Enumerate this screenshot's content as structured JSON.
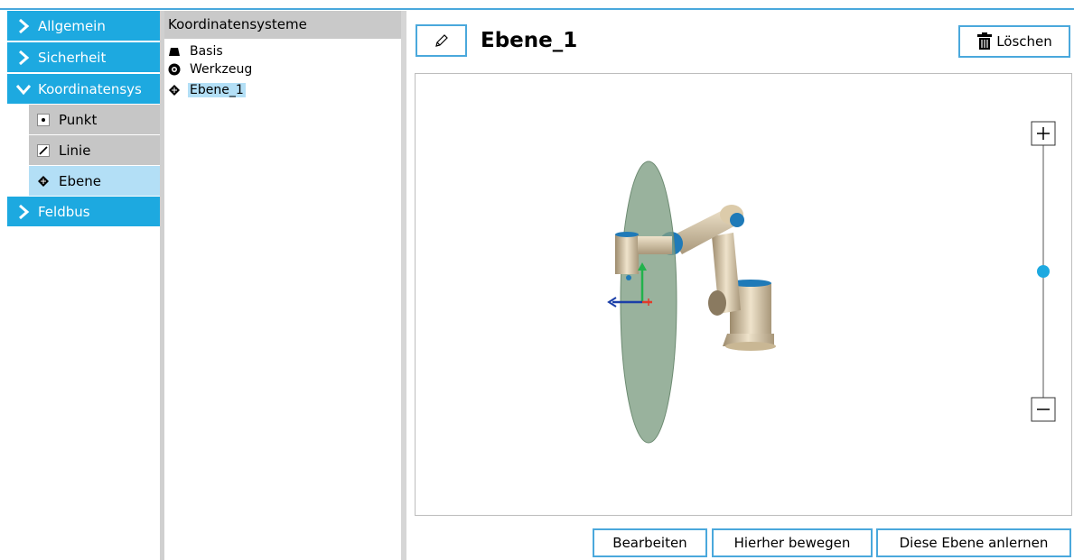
{
  "nav": {
    "items": [
      {
        "label": "Allgemein",
        "icon": "chevron-right-icon",
        "expanded": false
      },
      {
        "label": "Sicherheit",
        "icon": "chevron-right-icon",
        "expanded": false
      },
      {
        "label": "Koordinatensys",
        "icon": "chevron-down-icon",
        "expanded": true
      },
      {
        "label": "Feldbus",
        "icon": "chevron-right-icon",
        "expanded": false
      }
    ],
    "subitems": [
      {
        "label": "Punkt",
        "icon": "point-icon"
      },
      {
        "label": "Linie",
        "icon": "line-icon"
      },
      {
        "label": "Ebene",
        "icon": "plane-icon",
        "active": true
      }
    ]
  },
  "tree": {
    "header": "Koordinatensysteme",
    "items": [
      {
        "label": "Basis",
        "icon": "base-icon"
      },
      {
        "label": "Werkzeug",
        "icon": "tool-icon"
      },
      {
        "label": "Ebene_1",
        "icon": "plane-icon",
        "selected": true
      }
    ]
  },
  "main": {
    "title": "Ebene_1",
    "delete_label": "Löschen",
    "buttons": {
      "edit": "Bearbeiten",
      "move_here": "Hierher bewegen",
      "teach_plane": "Diese Ebene anlernen"
    },
    "zoom_level": 0.5
  },
  "colors": {
    "accent": "#1da9e0",
    "selection": "#b3dff6",
    "plane": "#7f9f84",
    "robot": "#d8c6a6",
    "joint": "#1f7ab8"
  }
}
